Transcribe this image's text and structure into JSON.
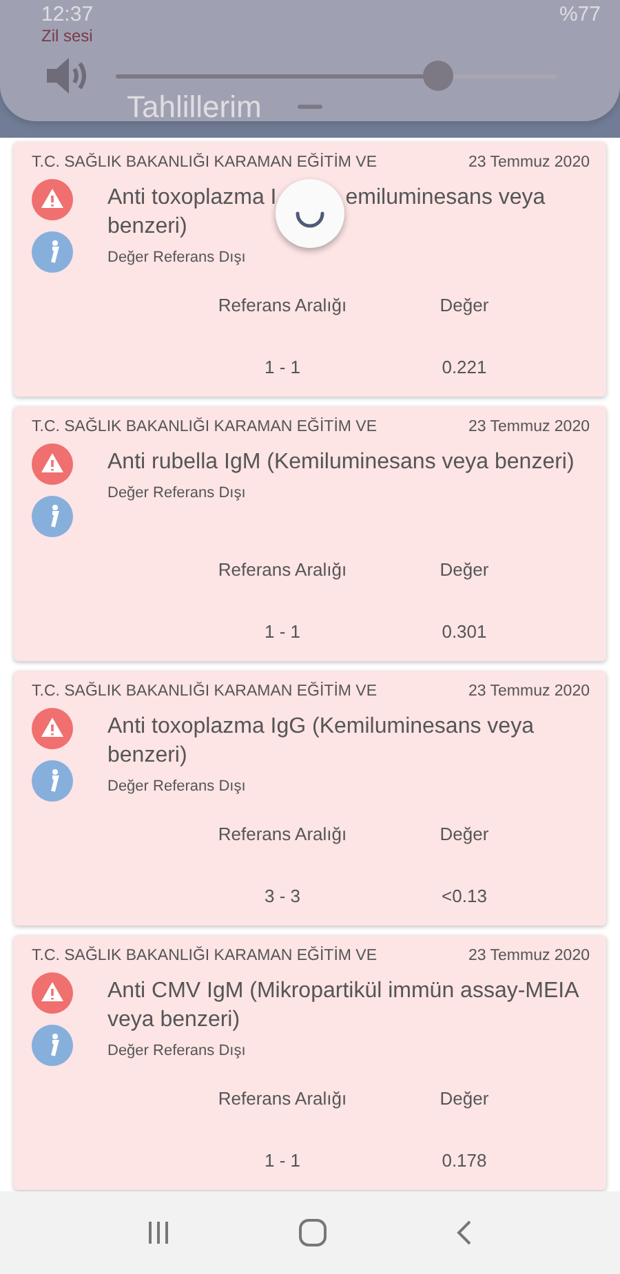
{
  "status_bar": {
    "time": "12:37",
    "battery": "%77"
  },
  "header": {
    "title": "Tahlillerim"
  },
  "volume_panel": {
    "label": "Zil sesi",
    "level": 0.73
  },
  "loading": true,
  "results": [
    {
      "institution": "T.C. SAĞLIK BAKANLIĞI KARAMAN EĞİTİM VE",
      "date": "23 Temmuz 2020",
      "test": [
        {
          "text": "Anti toxoplazma I",
          "covered_before": false
        },
        {
          "text": "emiluminesans veya",
          "covered_before": true
        },
        {
          "text": "benzeri)",
          "covered_before": false
        }
      ],
      "status": "Değer Referans Dışı",
      "out_of_range": true,
      "range_label": "Referans Aralığı",
      "value_label": "Değer",
      "range": "1 - 1",
      "value": "0.221"
    },
    {
      "institution": "T.C. SAĞLIK BAKANLIĞI KARAMAN EĞİTİM VE",
      "date": "23 Temmuz 2020",
      "test": [
        {
          "text": "Anti rubella IgM (Kemiluminesans veya benzeri)",
          "covered_before": false
        }
      ],
      "status": "Değer Referans Dışı",
      "out_of_range": true,
      "range_label": "Referans Aralığı",
      "value_label": "Değer",
      "range": "1 - 1",
      "value": "0.301"
    },
    {
      "institution": "T.C. SAĞLIK BAKANLIĞI KARAMAN EĞİTİM VE",
      "date": "23 Temmuz 2020",
      "test": [
        {
          "text": "Anti toxoplazma IgG (Kemiluminesans veya benzeri)",
          "covered_before": false
        }
      ],
      "status": "Değer Referans Dışı",
      "out_of_range": true,
      "range_label": "Referans Aralığı",
      "value_label": "Değer",
      "range": "3 - 3",
      "value": "<0.13"
    },
    {
      "institution": "T.C. SAĞLIK BAKANLIĞI KARAMAN EĞİTİM VE",
      "date": "23 Temmuz 2020",
      "test": [
        {
          "text": "Anti CMV IgM (Mikropartikül immün assay-MEIA veya benzeri)",
          "covered_before": false
        }
      ],
      "status": "Değer Referans Dışı",
      "out_of_range": true,
      "range_label": "Referans Aralığı",
      "value_label": "Değer",
      "range": "1 - 1",
      "value": "0.178"
    }
  ]
}
